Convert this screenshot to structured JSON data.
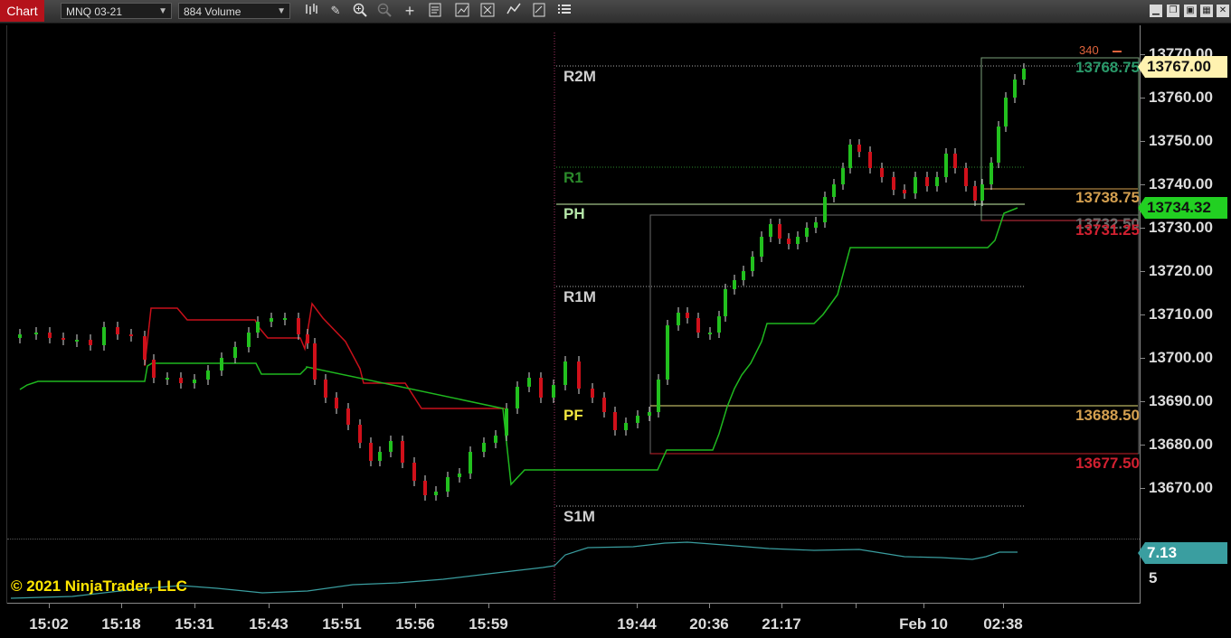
{
  "toolbar": {
    "tab_label": "Chart",
    "instrument": "MNQ 03-21",
    "interval": "884 Volume",
    "icons": [
      "bar-type-icon",
      "draw-pencil-icon",
      "zoom-in-icon",
      "zoom-out-icon",
      "crosshair-icon",
      "data-box-icon",
      "properties-icon",
      "strategy-icon",
      "indicators-icon",
      "templates-icon",
      "menu-icon"
    ]
  },
  "colors": {
    "up": "#22c01e",
    "down": "#d0101a",
    "accent": "#b5121b"
  },
  "y_axis": {
    "labels": [
      "13770.00",
      "13760.00",
      "13750.00",
      "13740.00",
      "13730.00",
      "13720.00",
      "13710.00",
      "13700.00",
      "13690.00",
      "13680.00",
      "13670.00"
    ],
    "lower_labels": [
      "5"
    ]
  },
  "x_axis": {
    "labels": [
      "15:02",
      "15:18",
      "15:31",
      "15:43",
      "15:51",
      "15:56",
      "15:59",
      "19:44",
      "20:36",
      "21:17",
      "Feb 10",
      "02:38"
    ]
  },
  "levels": {
    "r2m": "R2M",
    "r1": "R1",
    "ph": "PH",
    "r1m": "R1M",
    "pf": "PF",
    "s1m": "S1M",
    "v_13768": "13768.75",
    "v_13738": "13738.75",
    "v_13732": "13732.50",
    "v_13731": "13731.25",
    "v_13688": "13688.50",
    "v_13677": "13677.50"
  },
  "price_tags": {
    "last": "13767.00",
    "stop": "13734.32",
    "indicator": "7.13",
    "volume_count": "340"
  },
  "copyright": "© 2021 NinjaTrader, LLC"
}
